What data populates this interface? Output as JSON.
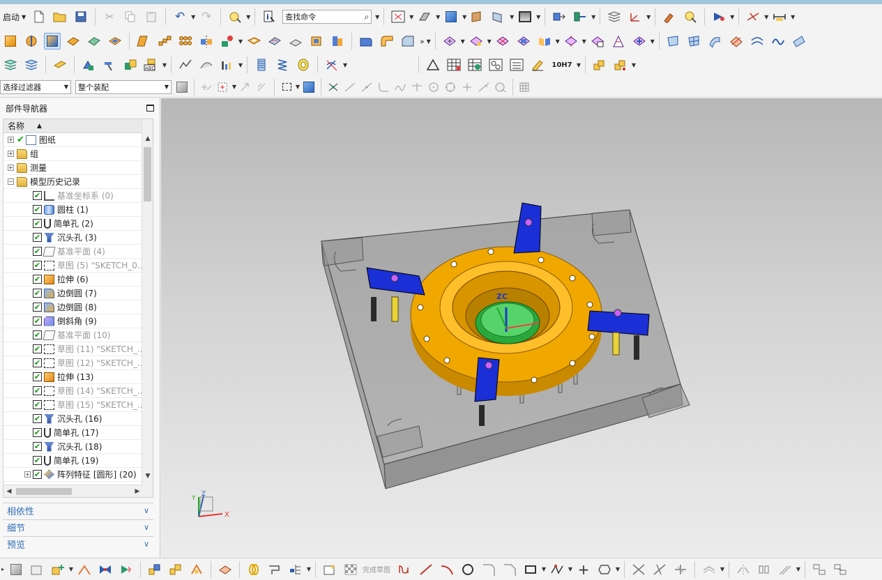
{
  "toolbar": {
    "start_menu": "启动",
    "command_search_placeholder": "查找命令",
    "selection_filter": "选择过滤器",
    "assembly_scope": "整个装配",
    "more_glyph": "»"
  },
  "navigator": {
    "title": "部件导航器",
    "column_name": "名称",
    "nodes": {
      "drawing": "图纸",
      "group": "组",
      "measure": "测量",
      "history": "模型历史记录"
    },
    "features": [
      {
        "label": "基准坐标系 (0)",
        "icon": "datum-csys-icon",
        "dim": true
      },
      {
        "label": "圆柱 (1)",
        "icon": "cylinder-icon",
        "dim": false
      },
      {
        "label": "简单孔 (2)",
        "icon": "simple-hole-icon",
        "dim": false
      },
      {
        "label": "沉头孔 (3)",
        "icon": "counterbore-hole-icon",
        "dim": false
      },
      {
        "label": "基准平面 (4)",
        "icon": "datum-plane-icon",
        "dim": true
      },
      {
        "label": "草图 (5) \"SKETCH_0...",
        "icon": "sketch-icon",
        "dim": true
      },
      {
        "label": "拉伸 (6)",
        "icon": "extrude-icon",
        "dim": false
      },
      {
        "label": "边倒圆 (7)",
        "icon": "edge-blend-icon",
        "dim": false
      },
      {
        "label": "边倒圆 (8)",
        "icon": "edge-blend-icon",
        "dim": false
      },
      {
        "label": "倒斜角 (9)",
        "icon": "chamfer-icon",
        "dim": false
      },
      {
        "label": "基准平面 (10)",
        "icon": "datum-plane-icon",
        "dim": true
      },
      {
        "label": "草图 (11) \"SKETCH_...",
        "icon": "sketch-icon",
        "dim": true
      },
      {
        "label": "草图 (12) \"SKETCH_...",
        "icon": "sketch-icon",
        "dim": true
      },
      {
        "label": "拉伸 (13)",
        "icon": "extrude-icon",
        "dim": false
      },
      {
        "label": "草图 (14) \"SKETCH_...",
        "icon": "sketch-icon",
        "dim": true
      },
      {
        "label": "草图 (15) \"SKETCH_...",
        "icon": "sketch-icon",
        "dim": true
      },
      {
        "label": "沉头孔 (16)",
        "icon": "counterbore-hole-icon",
        "dim": false
      },
      {
        "label": "简单孔 (17)",
        "icon": "simple-hole-icon",
        "dim": false
      },
      {
        "label": "沉头孔 (18)",
        "icon": "counterbore-hole-icon",
        "dim": false
      },
      {
        "label": "简单孔 (19)",
        "icon": "simple-hole-icon",
        "dim": false
      },
      {
        "label": "阵列特征 [圆形] (20)",
        "icon": "pattern-feature-icon",
        "dim": false
      }
    ],
    "panels": [
      "相依性",
      "细节",
      "预览"
    ]
  },
  "triad": {
    "x": "X",
    "y": "Y",
    "z": "Z"
  },
  "model_triad": {
    "z": "ZC"
  },
  "sketch_toolbar": {
    "finish_sketch": "完成草图"
  },
  "tolerance_label": "10H7",
  "colors": {
    "accent_blue": "#2e6db4",
    "model_gold": "#f0a800",
    "clamp_blue": "#1a2fd6",
    "plate_gray": "#8d8d8d"
  }
}
